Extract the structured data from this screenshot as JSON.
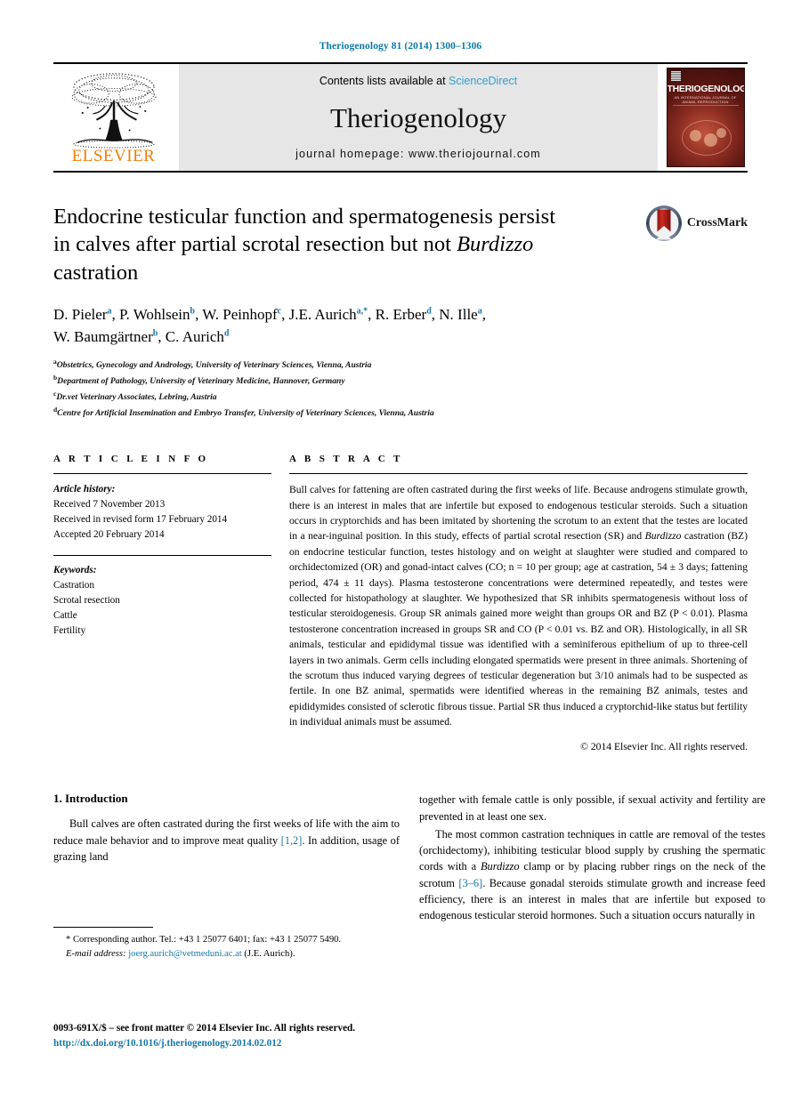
{
  "running_head": "Theriogenology 81 (2014) 1300–1306",
  "masthead": {
    "publisher_name": "ELSEVIER",
    "publisher_logo": "elsevier-tree-logo",
    "contents_prefix": "Contents lists available at",
    "contents_link": "ScienceDirect",
    "journal_name": "Theriogenology",
    "homepage": "journal homepage: www.theriojournal.com",
    "cover": {
      "title": "THERIOGENOLOGY",
      "subtitle": "AN INTERNATIONAL JOURNAL OF ANIMAL REPRODUCTION"
    }
  },
  "title": {
    "line1": "Endocrine testicular function and spermatogenesis persist",
    "line2_pre": "in calves after partial scrotal resection but not ",
    "line2_italic": "Burdizzo",
    "line3": "castration"
  },
  "crossmark": {
    "label": "CrossMark",
    "icon": "crossmark-badge-icon"
  },
  "authors": [
    {
      "name": "D. Pieler",
      "sup": "a",
      "sep": ", "
    },
    {
      "name": "P. Wohlsein",
      "sup": "b",
      "sep": ", "
    },
    {
      "name": "W. Peinhopf",
      "sup": "c",
      "sep": ", "
    },
    {
      "name": "J.E. Aurich",
      "sup": "a,*",
      "sep": ", "
    },
    {
      "name": "R. Erber",
      "sup": "d",
      "sep": ", "
    },
    {
      "name": "N. Ille",
      "sup": "a",
      "sep": ", "
    },
    {
      "name": "W. Baumgärtner",
      "sup": "b",
      "sep": ", "
    },
    {
      "name": "C. Aurich",
      "sup": "d",
      "sep": ""
    }
  ],
  "affiliations": [
    {
      "mark": "a",
      "text": "Obstetrics, Gynecology and Andrology, University of Veterinary Sciences, Vienna, Austria"
    },
    {
      "mark": "b",
      "text": "Department of Pathology, University of Veterinary Medicine, Hannover, Germany"
    },
    {
      "mark": "c",
      "text": "Dr.vet Veterinary Associates, Lebring, Austria"
    },
    {
      "mark": "d",
      "text": "Centre for Artificial Insemination and Embryo Transfer, University of Veterinary Sciences, Vienna, Austria"
    }
  ],
  "article_info": {
    "heading": "A R T I C L E    I N F O",
    "history_label": "Article history:",
    "history": [
      "Received 7 November 2013",
      "Received in revised form 17 February 2014",
      "Accepted 20 February 2014"
    ],
    "keywords_label": "Keywords:",
    "keywords": [
      "Castration",
      "Scrotal resection",
      "Cattle",
      "Fertility"
    ]
  },
  "abstract": {
    "heading": "A B S T R A C T",
    "p1": "Bull calves for fattening are often castrated during the first weeks of life. Because androgens stimulate growth, there is an interest in males that are infertile but exposed to endogenous testicular steroids. Such a situation occurs in cryptorchids and has been imitated by shortening the scrotum to an extent that the testes are located in a near-inguinal position. In this study, effects of partial scrotal resection (SR) and ",
    "p1_italic": "Burdizzo",
    "p2": " castration (BZ) on endocrine testicular function, testes histology and on weight at slaughter were studied and compared to orchidectomized (OR) and gonad-intact calves (CO; n = 10 per group; age at castration, 54 ± 3 days; fattening period, 474 ± 11 days). Plasma testosterone concentrations were determined repeatedly, and testes were collected for histopathology at slaughter. We hypothesized that SR inhibits spermatogenesis without loss of testicular steroidogenesis. Group SR animals gained more weight than groups OR and BZ (P < 0.01). Plasma testosterone concentration increased in groups SR and CO (P < 0.01 vs. BZ and OR). Histologically, in all SR animals, testicular and epididymal tissue was identified with a seminiferous epithelium of up to three-cell layers in two animals. Germ cells including elongated spermatids were present in three animals. Shortening of the scrotum thus induced varying degrees of testicular degeneration but 3/10 animals had to be suspected as fertile. In one BZ animal, spermatids were identified whereas in the remaining BZ animals, testes and epididymides consisted of sclerotic fibrous tissue. Partial SR thus induced a cryptorchid-like status but fertility in individual animals must be assumed.",
    "copyright": "© 2014 Elsevier Inc. All rights reserved."
  },
  "body": {
    "section_number_title": "1.  Introduction",
    "left_p1_a": "Bull calves are often castrated during the first weeks of life with the aim to reduce male behavior and to improve meat quality ",
    "left_p1_ref": "[1,2]",
    "left_p1_b": ". In addition, usage of grazing land",
    "right_p1_cont": "together with female cattle is only possible, if sexual activity and fertility are prevented in at least one sex.",
    "right_p2_a": "The most common castration techniques in cattle are removal of the testes (orchidectomy), inhibiting testicular blood supply by crushing the spermatic cords with a ",
    "right_p2_italic": "Burdizzo",
    "right_p2_b": " clamp or by placing rubber rings on the neck of the scrotum ",
    "right_p2_ref": "[3–6]",
    "right_p2_c": ". Because gonadal steroids stimulate growth and increase feed efficiency, there is an interest in males that are infertile but exposed to endogenous testicular steroid hormones. Such a situation occurs naturally in"
  },
  "footnote": {
    "star_line": "* Corresponding author. Tel.: +43 1 25077 6401; fax: +43 1 25077 5490.",
    "email_label": "E-mail address:",
    "email": "joerg.aurich@vetmeduni.ac.at",
    "email_suffix": "(J.E. Aurich)."
  },
  "page_footer": {
    "issn_line": "0093-691X/$ – see front matter © 2014 Elsevier Inc. All rights reserved.",
    "doi_line": "http://dx.doi.org/10.1016/j.theriogenology.2014.02.012"
  },
  "colors": {
    "link_blue": "#1577a8",
    "sciencedirect_blue": "#2f9fd0",
    "elsevier_orange": "#f07f09",
    "masthead_gray": "#e6e6e6",
    "crossmark_red": "#b5211d"
  }
}
